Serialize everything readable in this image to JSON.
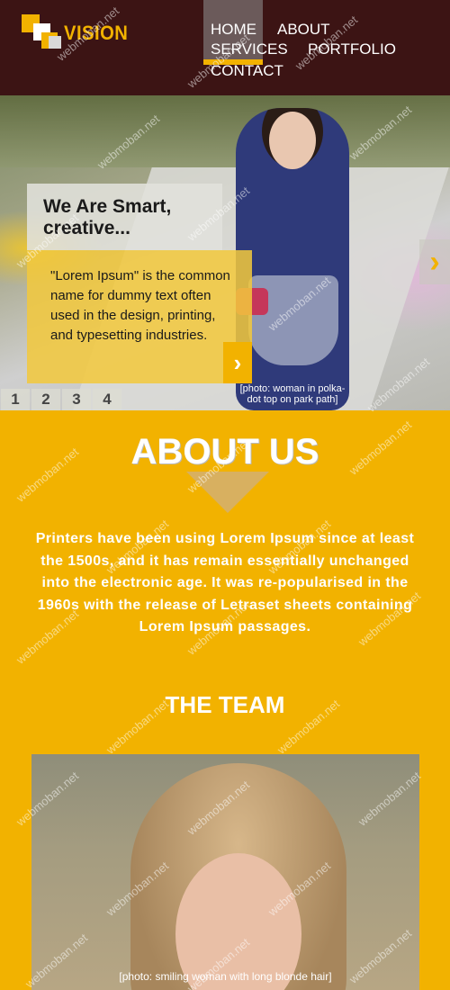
{
  "header": {
    "brand": "VISION",
    "nav": [
      {
        "label": "HOME",
        "active": true
      },
      {
        "label": "ABOUT"
      },
      {
        "label": "SERVICES"
      },
      {
        "label": "PORTFOLIO"
      },
      {
        "label": "CONTACT"
      }
    ]
  },
  "hero": {
    "title": "We Are Smart, creative...",
    "text": "\"Lorem Ipsum\" is the common name for dummy text often used in the design, printing, and typesetting industries.",
    "photo_label": "[photo: woman in polka-dot top on park path]",
    "pager": [
      "1",
      "2",
      "3",
      "4"
    ]
  },
  "about": {
    "title": "ABOUT US",
    "text": "Printers have been using Lorem Ipsum since at least the 1500s, and it has remain essentially unchanged into the electronic age. It was re-popularised in the 1960s with the release of Letraset sheets containing Lorem Ipsum passages."
  },
  "team": {
    "title": "THE TEAM",
    "photo_label": "[photo: smiling woman with long blonde hair]"
  },
  "watermark": "webmoban.net",
  "colors": {
    "header_bg": "#3c1414",
    "accent": "#f2b200",
    "text_light": "#ffffff"
  }
}
